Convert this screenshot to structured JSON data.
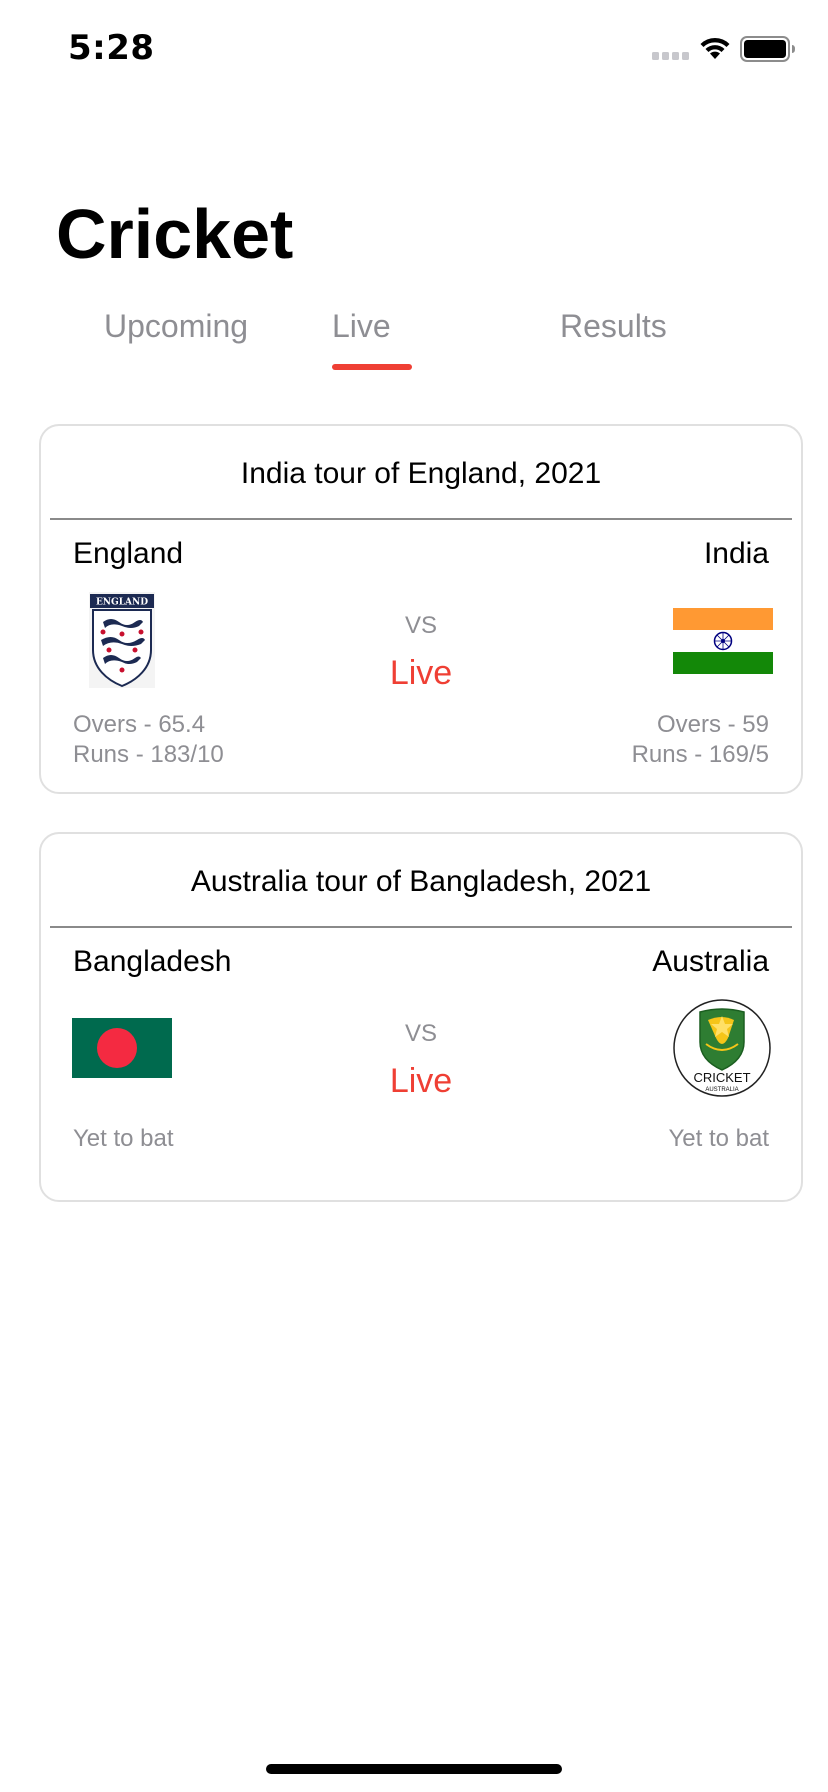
{
  "status_bar": {
    "time": "5:28",
    "icons": [
      "signal-icon",
      "wifi-icon",
      "battery-icon"
    ]
  },
  "page": {
    "title": "Cricket"
  },
  "tabs": [
    {
      "label": "Upcoming",
      "selected": false
    },
    {
      "label": "Live",
      "selected": true
    },
    {
      "label": "Results",
      "selected": false
    }
  ],
  "colors": {
    "accent": "#ef3f34",
    "secondary_text": "#8e8e93"
  },
  "matches": [
    {
      "title": "India tour of England, 2021",
      "vs_label": "VS",
      "status": "Live",
      "team_left": {
        "name": "England",
        "icon": "england-crest-icon",
        "crest_text": "ENGLAND",
        "overs": "Overs - 65.4",
        "runs": "Runs - 183/10"
      },
      "team_right": {
        "name": "India",
        "icon": "india-flag-icon",
        "overs": "Overs - 59",
        "runs": "Runs - 169/5"
      }
    },
    {
      "title": "Australia tour of Bangladesh, 2021",
      "vs_label": "VS",
      "status": "Live",
      "team_left": {
        "name": "Bangladesh",
        "icon": "bangladesh-flag-icon",
        "batting_status": "Yet to bat"
      },
      "team_right": {
        "name": "Australia",
        "icon": "cricket-australia-logo-icon",
        "logo_text": "CRICKET",
        "logo_subtext": "AUSTRALIA",
        "batting_status": "Yet to bat"
      }
    }
  ]
}
